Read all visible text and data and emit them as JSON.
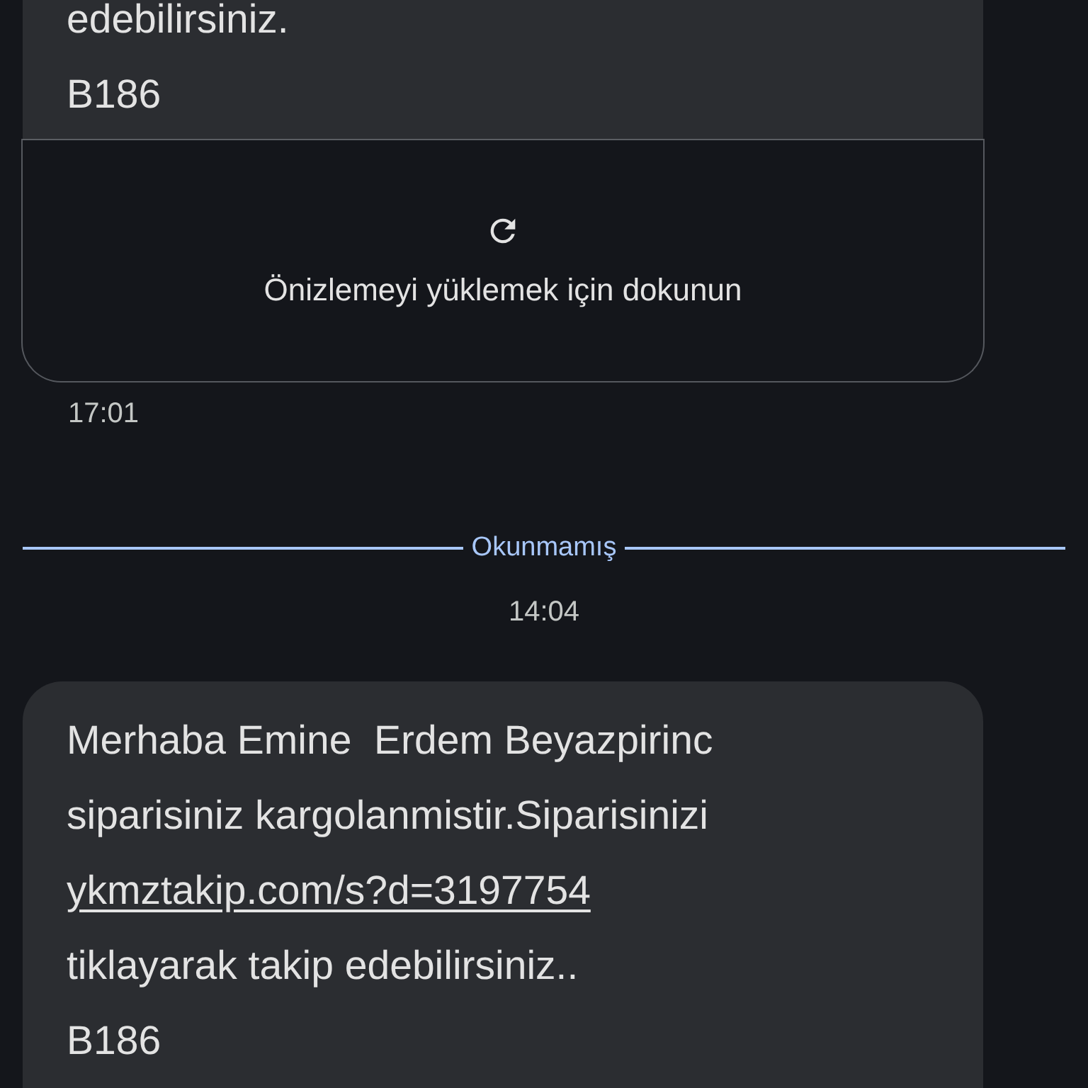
{
  "items": [
    {
      "kind": "message",
      "lines": [
        {
          "kind": "text",
          "text": "edebilirsiniz."
        },
        {
          "kind": "text",
          "text": "B186"
        }
      ],
      "preview": {
        "action": "Önizlemeyi yüklemek için dokunun"
      }
    },
    {
      "kind": "message_time",
      "text": "17:01"
    },
    {
      "kind": "divider",
      "text": "Okunmamış"
    },
    {
      "kind": "timestamp",
      "text": "14:04"
    },
    {
      "kind": "message",
      "lines": [
        {
          "kind": "text",
          "text": "Merhaba Emine  Erdem Beyazpirinc"
        },
        {
          "kind": "text",
          "text": "siparisiniz kargolanmistir.Siparisinizi"
        },
        {
          "kind": "link",
          "text": "ykmztakip.com/s?d=3197754"
        },
        {
          "kind": "text",
          "text": "tiklayarak takip edebilirsiniz.."
        },
        {
          "kind": "text",
          "text": "B186"
        }
      ]
    }
  ]
}
